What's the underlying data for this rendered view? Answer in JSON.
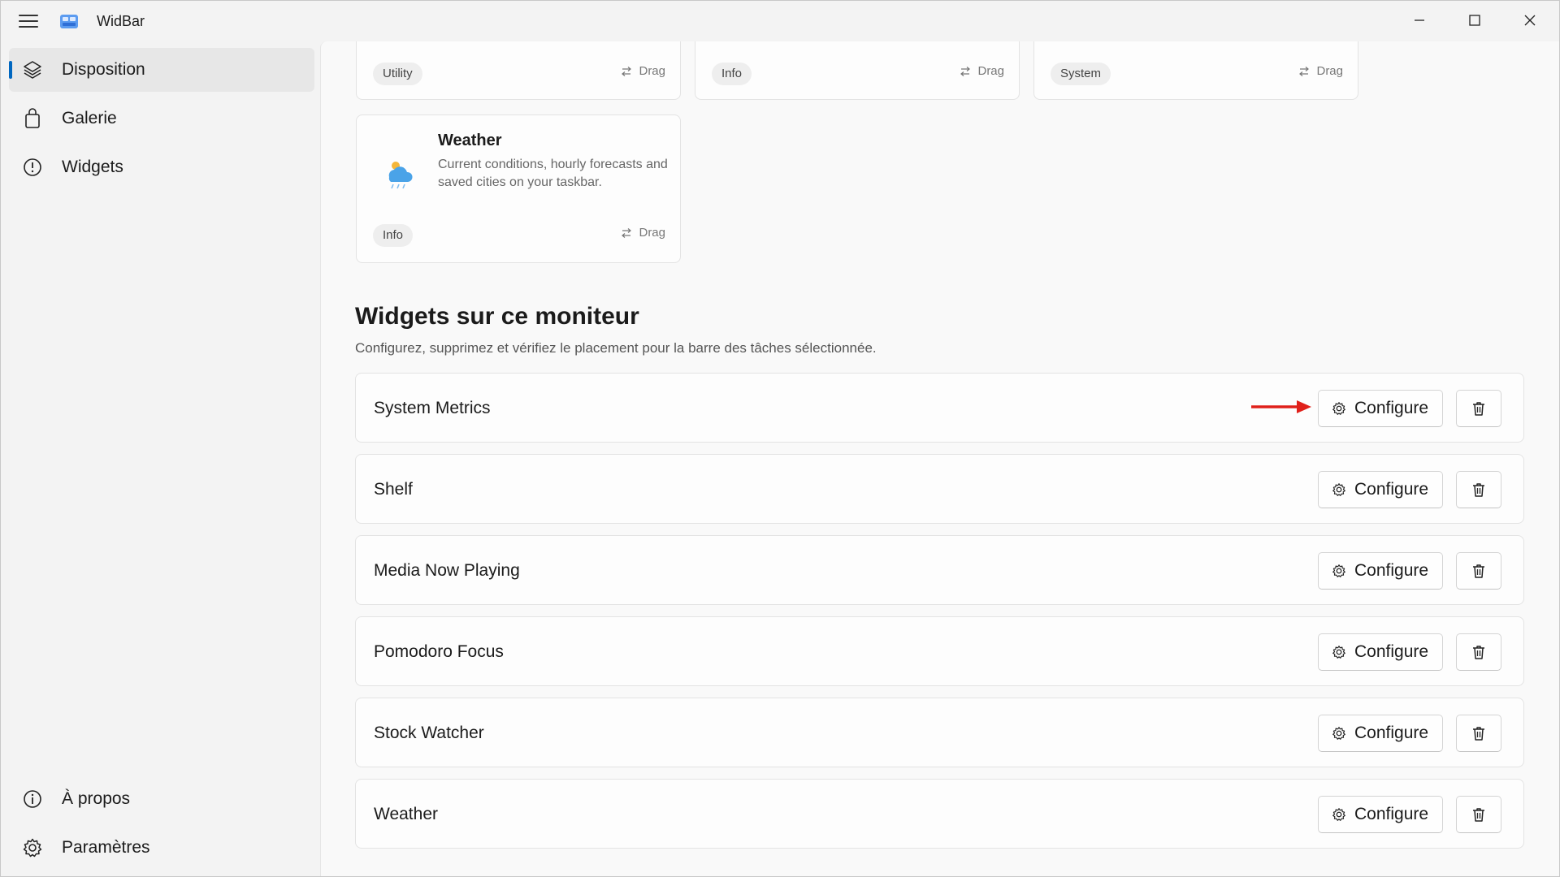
{
  "app": {
    "title": "WidBar"
  },
  "sidebar": {
    "items": [
      {
        "label": "Disposition",
        "icon": "layers-icon",
        "active": true
      },
      {
        "label": "Galerie",
        "icon": "shopping-bag-icon"
      },
      {
        "label": "Widgets",
        "icon": "info-circle-icon"
      }
    ],
    "footer": [
      {
        "label": "À propos",
        "icon": "info-icon"
      },
      {
        "label": "Paramètres",
        "icon": "gear-icon"
      }
    ]
  },
  "gallery": {
    "top_cards": [
      {
        "tag": "Utility",
        "drag": "Drag"
      },
      {
        "tag": "Info",
        "drag": "Drag"
      },
      {
        "tag": "System",
        "drag": "Drag"
      }
    ],
    "weather_card": {
      "title": "Weather",
      "description": "Current conditions, hourly forecasts and saved cities on your taskbar.",
      "tag": "Info",
      "drag": "Drag"
    }
  },
  "section": {
    "title": "Widgets sur ce moniteur",
    "subtitle": "Configurez, supprimez et vérifiez le placement pour la barre des tâches sélectionnée."
  },
  "widgets": [
    {
      "name": "System Metrics",
      "configure": "Configure"
    },
    {
      "name": "Shelf",
      "configure": "Configure"
    },
    {
      "name": "Media Now Playing",
      "configure": "Configure"
    },
    {
      "name": "Pomodoro Focus",
      "configure": "Configure"
    },
    {
      "name": "Stock Watcher",
      "configure": "Configure"
    },
    {
      "name": "Weather",
      "configure": "Configure"
    }
  ],
  "colors": {
    "accent": "#0067c0",
    "annotation_arrow": "#e0201a"
  }
}
